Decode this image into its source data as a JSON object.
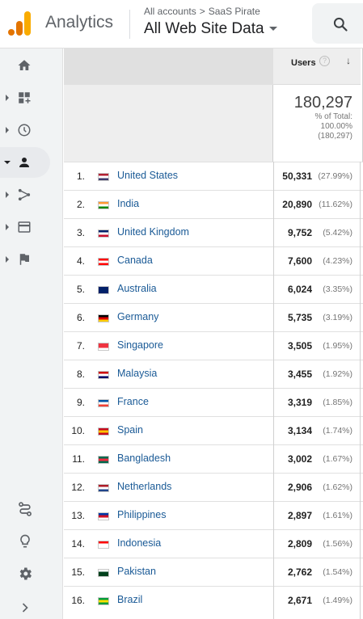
{
  "app": {
    "title": "Analytics"
  },
  "breadcrumb": {
    "account": "All accounts",
    "separator": ">",
    "property": "SaaS Pirate"
  },
  "view": {
    "name": "All Web Site Data"
  },
  "table": {
    "metric_header": "Users",
    "help": "?",
    "sort_indicator": "↓",
    "total_value": "180,297",
    "total_pct_label": "% of Total:",
    "total_pct": "100.00%",
    "total_paren": "(180,297)",
    "rows": [
      {
        "rank": "1.",
        "country": "United States",
        "users": "50,331",
        "pct": "(27.99%)",
        "flag": [
          "#b22234",
          "#ffffff",
          "#3c3b6e"
        ]
      },
      {
        "rank": "2.",
        "country": "India",
        "users": "20,890",
        "pct": "(11.62%)",
        "flag": [
          "#ff9933",
          "#ffffff",
          "#138808"
        ]
      },
      {
        "rank": "3.",
        "country": "United Kingdom",
        "users": "9,752",
        "pct": "(5.42%)",
        "flag": [
          "#012169",
          "#ffffff",
          "#c8102e"
        ]
      },
      {
        "rank": "4.",
        "country": "Canada",
        "users": "7,600",
        "pct": "(4.23%)",
        "flag": [
          "#ff0000",
          "#ffffff",
          "#ff0000"
        ]
      },
      {
        "rank": "5.",
        "country": "Australia",
        "users": "6,024",
        "pct": "(3.35%)",
        "flag": [
          "#012169",
          "#012169",
          "#012169"
        ]
      },
      {
        "rank": "6.",
        "country": "Germany",
        "users": "5,735",
        "pct": "(3.19%)",
        "flag": [
          "#000000",
          "#dd0000",
          "#ffce00"
        ]
      },
      {
        "rank": "7.",
        "country": "Singapore",
        "users": "3,505",
        "pct": "(1.95%)",
        "flag": [
          "#ef3340",
          "#ef3340",
          "#ffffff"
        ]
      },
      {
        "rank": "8.",
        "country": "Malaysia",
        "users": "3,455",
        "pct": "(1.92%)",
        "flag": [
          "#cc0001",
          "#ffffff",
          "#010066"
        ]
      },
      {
        "rank": "9.",
        "country": "France",
        "users": "3,319",
        "pct": "(1.85%)",
        "flag": [
          "#0055a4",
          "#ffffff",
          "#ef4135"
        ]
      },
      {
        "rank": "10.",
        "country": "Spain",
        "users": "3,134",
        "pct": "(1.74%)",
        "flag": [
          "#c60b1e",
          "#ffc400",
          "#c60b1e"
        ]
      },
      {
        "rank": "11.",
        "country": "Bangladesh",
        "users": "3,002",
        "pct": "(1.67%)",
        "flag": [
          "#006a4e",
          "#f42a41",
          "#006a4e"
        ]
      },
      {
        "rank": "12.",
        "country": "Netherlands",
        "users": "2,906",
        "pct": "(1.62%)",
        "flag": [
          "#ae1c28",
          "#ffffff",
          "#21468b"
        ]
      },
      {
        "rank": "13.",
        "country": "Philippines",
        "users": "2,897",
        "pct": "(1.61%)",
        "flag": [
          "#0038a8",
          "#ce1126",
          "#ffffff"
        ]
      },
      {
        "rank": "14.",
        "country": "Indonesia",
        "users": "2,809",
        "pct": "(1.56%)",
        "flag": [
          "#ff0000",
          "#ffffff",
          "#ffffff"
        ]
      },
      {
        "rank": "15.",
        "country": "Pakistan",
        "users": "2,762",
        "pct": "(1.54%)",
        "flag": [
          "#ffffff",
          "#01411c",
          "#01411c"
        ]
      },
      {
        "rank": "16.",
        "country": "Brazil",
        "users": "2,671",
        "pct": "(1.49%)",
        "flag": [
          "#009c3b",
          "#ffdf00",
          "#009c3b"
        ]
      }
    ]
  },
  "icons": {
    "nav": [
      "home-icon",
      "customization-icon",
      "realtime-icon",
      "audience-icon",
      "acquisition-icon",
      "behavior-icon",
      "conversions-icon"
    ],
    "bottom": [
      "attribution-icon",
      "discover-icon",
      "admin-gear-icon",
      "expand-chevron-icon"
    ]
  }
}
